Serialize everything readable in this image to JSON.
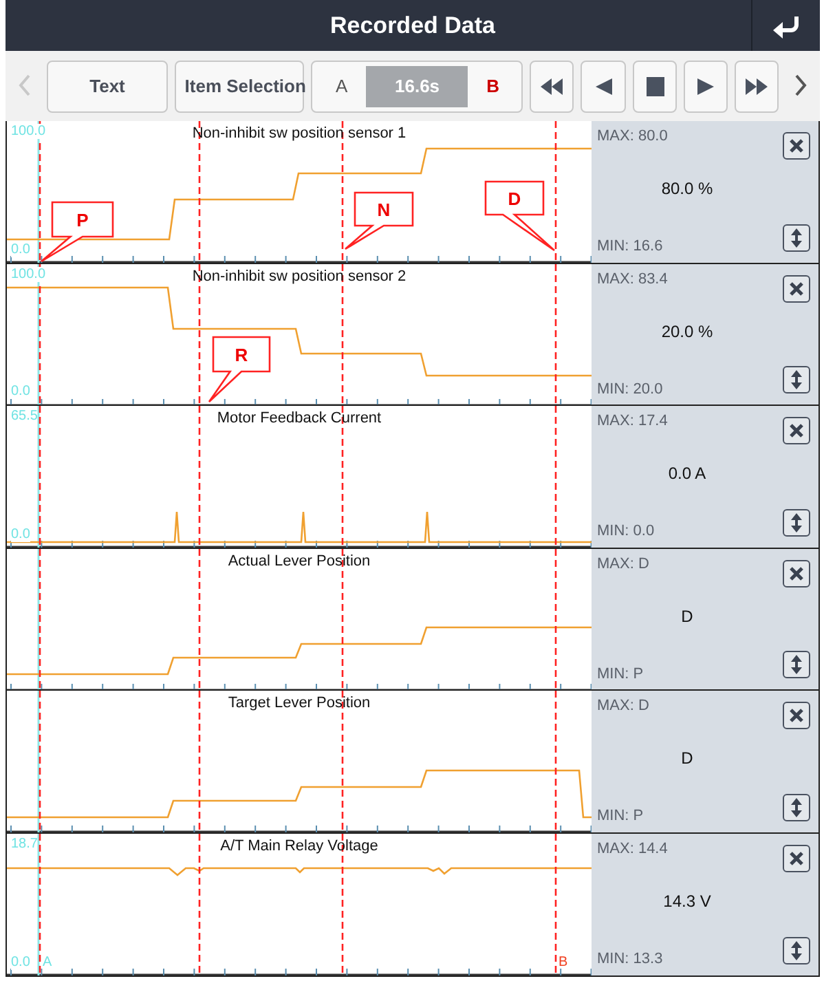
{
  "title": "Recorded Data",
  "toolbar": {
    "buttons": [
      "Text",
      "Item Selection"
    ],
    "cursor": {
      "a_label": "A",
      "time": "16.6s",
      "b_label": "B"
    }
  },
  "channels": [
    {
      "name": "Non-inhibit sw position sensor 1",
      "axis_max": "100.0",
      "axis_min": "0.0",
      "kind": "steps-up",
      "max": "MAX: 80.0",
      "value": "80.0 %",
      "min": "MIN: 16.6",
      "callouts": [
        {
          "label": "P"
        },
        {
          "label": "N"
        },
        {
          "label": "D"
        }
      ]
    },
    {
      "name": "Non-inhibit sw position sensor 2",
      "axis_max": "100.0",
      "axis_min": "0.0",
      "kind": "steps-down",
      "max": "MAX: 83.4",
      "value": "20.0 %",
      "min": "MIN: 20.0",
      "callouts": [
        {
          "label": "R"
        }
      ]
    },
    {
      "name": "Motor Feedback Current",
      "axis_max": "65.5",
      "axis_min": "0.0",
      "kind": "spikes",
      "max": "MAX: 17.4",
      "value": "0.0 A",
      "min": "MIN: 0.0"
    },
    {
      "name": "Actual Lever Position",
      "kind": "steps-up-small",
      "max": "MAX: D",
      "value": "D",
      "min": "MIN: P"
    },
    {
      "name": "Target Lever Position",
      "kind": "steps-up-drop",
      "max": "MAX: D",
      "value": "D",
      "min": "MIN: P"
    },
    {
      "name": "A/T Main Relay Voltage",
      "axis_max": "18.7",
      "axis_min": "0.0",
      "kind": "ripple",
      "max": "MAX: 14.4",
      "value": "14.3 V",
      "min": "MIN: 13.3"
    }
  ],
  "cursor_marks": [
    "A",
    "B"
  ]
}
